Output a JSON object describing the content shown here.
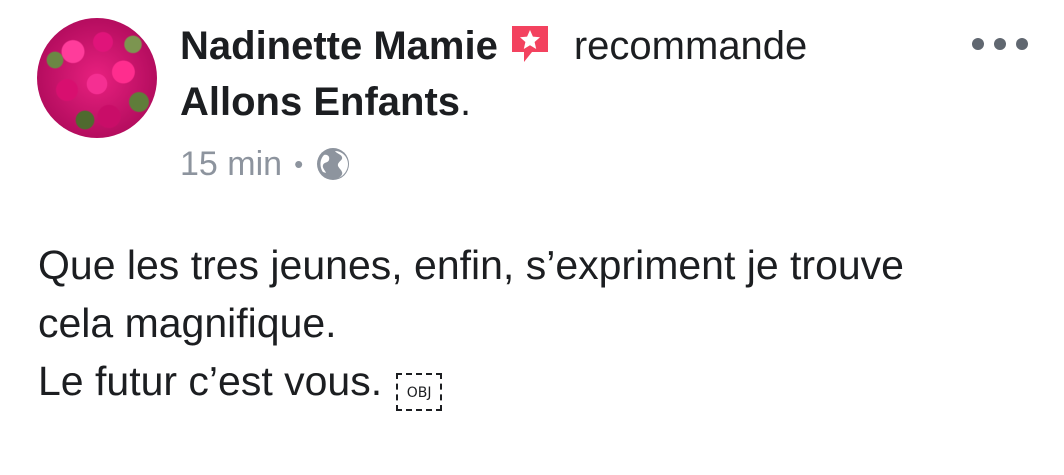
{
  "post": {
    "author": "Nadinette Mamie",
    "verb": "recommande",
    "page_name": "Allons Enfants",
    "page_suffix": ".",
    "timestamp": "15 min",
    "separator": "•",
    "privacy_icon": "globe-icon",
    "recommend_icon": "recommend-star-icon",
    "more_icon": "more-options-icon",
    "body_lines": [
      "Que les tres jeunes, enfin, s’expriment je trouve",
      "cela magnifique.",
      "Le futur c’est vous."
    ],
    "obj_placeholder": "OBJ"
  },
  "colors": {
    "text": "#1c1e21",
    "meta_text": "#8d949e",
    "recommend_badge": "#f3425f",
    "more_dots": "#606770"
  }
}
